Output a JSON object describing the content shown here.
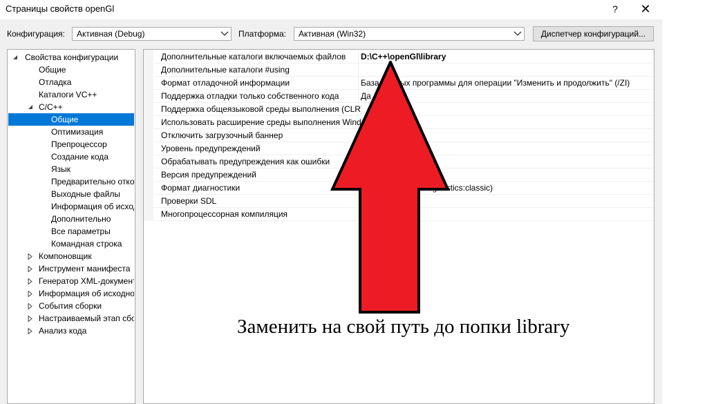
{
  "window": {
    "title": "Страницы свойств openGl",
    "help": "?",
    "close": "✕"
  },
  "config": {
    "config_label": "Конфигурация:",
    "config_value": "Активная (Debug)",
    "platform_label": "Платформа:",
    "platform_value": "Активная (Win32)",
    "manager_button": "Диспетчер конфигураций..."
  },
  "tree": {
    "items": [
      {
        "label": "Свойства конфигурации",
        "expander": "open"
      },
      {
        "label": "Общие",
        "expander": "none"
      },
      {
        "label": "Отладка",
        "expander": "none"
      },
      {
        "label": "Каталоги VC++",
        "expander": "none"
      },
      {
        "label": "C/C++",
        "expander": "open"
      },
      {
        "label": "Общие",
        "expander": "none",
        "selected": true
      },
      {
        "label": "Оптимизация",
        "expander": "none"
      },
      {
        "label": "Препроцессор",
        "expander": "none"
      },
      {
        "label": "Создание кода",
        "expander": "none"
      },
      {
        "label": "Язык",
        "expander": "none"
      },
      {
        "label": "Предварительно откомпилированные заголовки",
        "expander": "none"
      },
      {
        "label": "Выходные файлы",
        "expander": "none"
      },
      {
        "label": "Информация об исходном коде",
        "expander": "none"
      },
      {
        "label": "Дополнительно",
        "expander": "none"
      },
      {
        "label": "Все параметры",
        "expander": "none"
      },
      {
        "label": "Командная строка",
        "expander": "none"
      },
      {
        "label": "Компоновщик",
        "expander": "closed"
      },
      {
        "label": "Инструмент манифеста",
        "expander": "closed"
      },
      {
        "label": "Генератор XML-документов",
        "expander": "closed"
      },
      {
        "label": "Информация об исходном коде",
        "expander": "closed"
      },
      {
        "label": "События сборки",
        "expander": "closed"
      },
      {
        "label": "Настраиваемый этап сборки",
        "expander": "closed"
      },
      {
        "label": "Анализ кода",
        "expander": "closed"
      }
    ]
  },
  "properties": [
    {
      "name": "Дополнительные каталоги включаемых файлов",
      "value": "D:\\C++\\openGl\\library",
      "bold": true
    },
    {
      "name": "Дополнительные каталоги #using",
      "value": ""
    },
    {
      "name": "Формат отладочной информации",
      "value": "База данных программы для операции \"Изменить и продолжить\" (/ZI)"
    },
    {
      "name": "Поддержка отладки только собственного кода",
      "value": "Да (/JMC)"
    },
    {
      "name": "Поддержка общеязыковой среды выполнения (CLR)",
      "value": ""
    },
    {
      "name": "Использовать расширение среды выполнения Windows",
      "value": ""
    },
    {
      "name": "Отключить загрузочный баннер",
      "value": ""
    },
    {
      "name": "Уровень предупреждений",
      "value": ""
    },
    {
      "name": "Обрабатывать предупреждения как ошибки",
      "value": ""
    },
    {
      "name": "Версия предупреждений",
      "value": ""
    },
    {
      "name": "Формат диагностики",
      "value": "Классический (/diagnostics:classic)"
    },
    {
      "name": "Проверки SDL",
      "value": ""
    },
    {
      "name": "Многопроцессорная компиляция",
      "value": ""
    }
  ],
  "annotation": {
    "caption": "Заменить на свой путь до попки library",
    "arrow_color": "#ed1c24"
  }
}
